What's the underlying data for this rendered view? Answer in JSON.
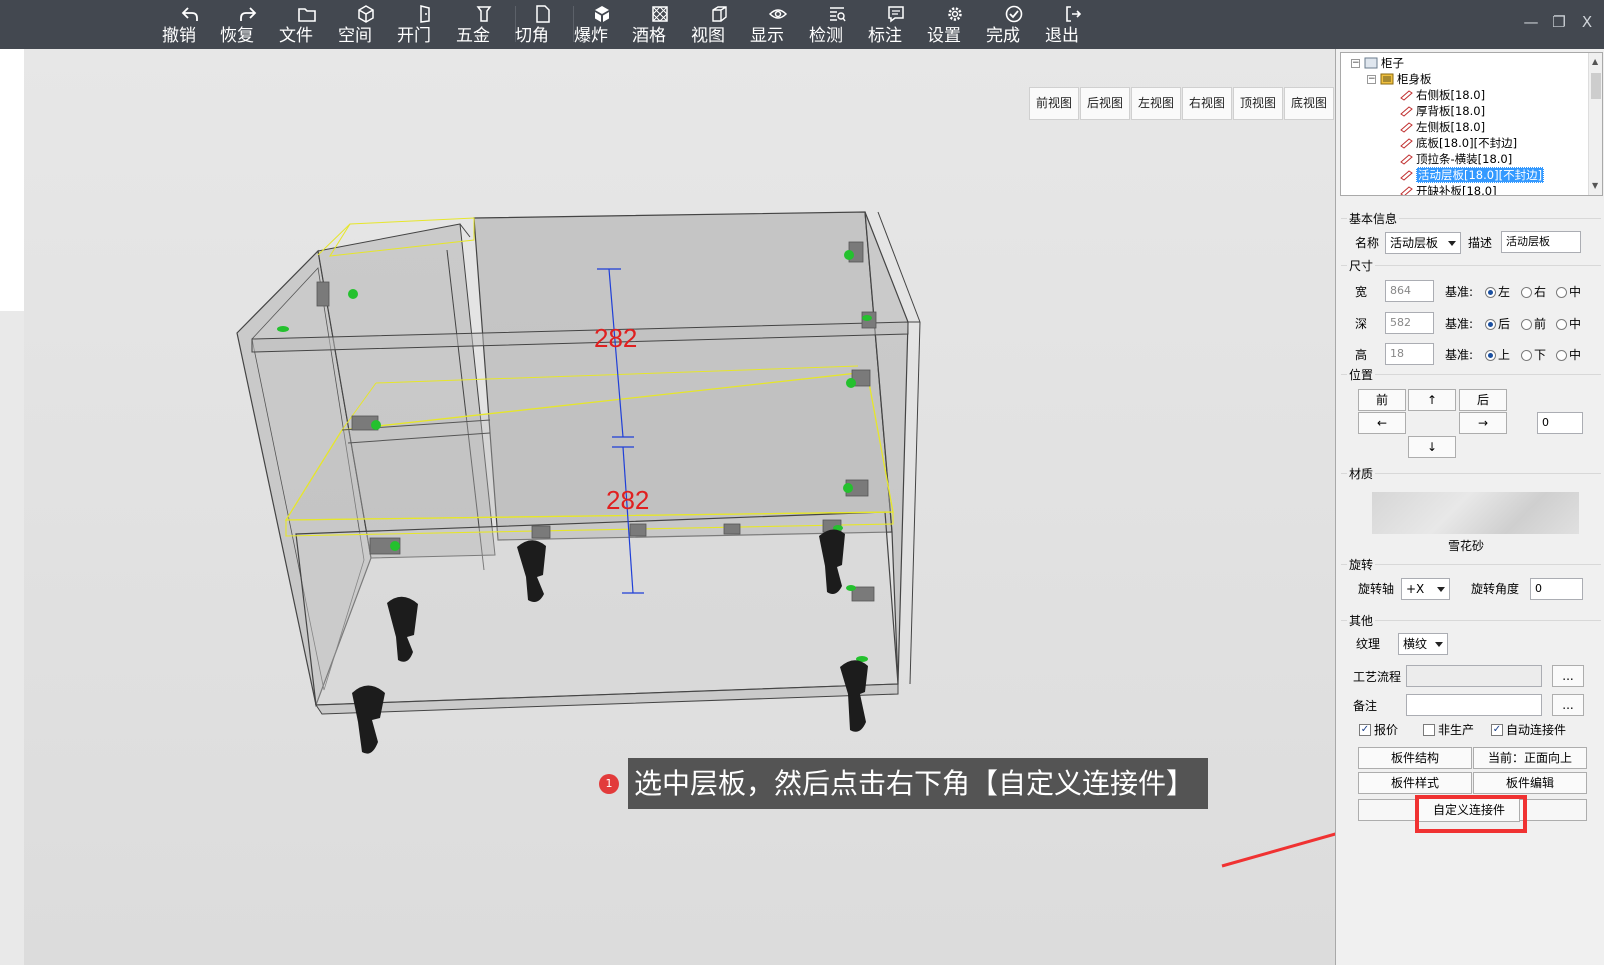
{
  "toolbar": {
    "items": [
      {
        "label": "撤销",
        "icon": "undo-icon"
      },
      {
        "label": "恢复",
        "icon": "redo-icon"
      },
      {
        "label": "文件",
        "icon": "folder-icon"
      },
      {
        "label": "空间",
        "icon": "cube-outline-icon"
      },
      {
        "label": "开门",
        "icon": "door-icon"
      },
      {
        "label": "五金",
        "icon": "hardware-icon"
      },
      {
        "label": "切角",
        "icon": "page-corner-icon"
      },
      {
        "label": "爆炸",
        "icon": "explode-cube-icon"
      },
      {
        "label": "酒格",
        "icon": "wine-grid-icon"
      },
      {
        "label": "视图",
        "icon": "view-cube-icon"
      },
      {
        "label": "显示",
        "icon": "eye-icon"
      },
      {
        "label": "检测",
        "icon": "check-list-icon"
      },
      {
        "label": "标注",
        "icon": "comment-icon"
      },
      {
        "label": "设置",
        "icon": "gear-icon"
      },
      {
        "label": "完成",
        "icon": "check-circle-icon"
      },
      {
        "label": "退出",
        "icon": "exit-icon"
      }
    ],
    "window": {
      "minimize": "—",
      "restore": "❐",
      "close": "X"
    }
  },
  "viewport": {
    "view_buttons": [
      "前视图",
      "后视图",
      "左视图",
      "右视图",
      "顶视图",
      "底视图"
    ],
    "dimension_top": "282",
    "dimension_bottom": "282",
    "callout_number": "1",
    "callout_text": "选中层板，然后点击右下角【自定义连接件】"
  },
  "tree": {
    "root": "柜子",
    "group": "柜身板",
    "items": [
      "右侧板[18.0]",
      "厚背板[18.0]",
      "左侧板[18.0]",
      "底板[18.0][不封边]",
      "顶拉条-横装[18.0]",
      "活动层板[18.0][不封边]",
      "开缺补板[18.0]"
    ],
    "selected_index": 5
  },
  "basic_info": {
    "title": "基本信息",
    "name_label": "名称",
    "name_value": "活动层板",
    "desc_label": "描述",
    "desc_value": "活动层板"
  },
  "size": {
    "title": "尺寸",
    "rows": [
      {
        "label": "宽",
        "value": "864",
        "base": "基准:",
        "options": [
          "左",
          "右",
          "中"
        ],
        "selected": 0
      },
      {
        "label": "深",
        "value": "582",
        "base": "基准:",
        "options": [
          "后",
          "前",
          "中"
        ],
        "selected": 0
      },
      {
        "label": "高",
        "value": "18",
        "base": "基准:",
        "options": [
          "上",
          "下",
          "中"
        ],
        "selected": 0
      }
    ]
  },
  "position": {
    "title": "位置",
    "front": "前",
    "up": "↑",
    "back": "后",
    "left": "←",
    "right": "→",
    "down": "↓",
    "step_value": "0"
  },
  "material": {
    "title": "材质",
    "name": "雪花砂"
  },
  "rotation": {
    "title": "旋转",
    "axis_label": "旋转轴",
    "axis_value": "+X",
    "angle_label": "旋转角度",
    "angle_value": "0"
  },
  "other": {
    "title": "其他",
    "texture_label": "纹理",
    "texture_value": "横纹",
    "process_label": "工艺流程",
    "remark_label": "备注",
    "more": "...",
    "checks": [
      {
        "label": "报价",
        "checked": true
      },
      {
        "label": "非生产",
        "checked": false
      },
      {
        "label": "自动连接件",
        "checked": true
      }
    ],
    "btn_structure": "板件结构",
    "btn_current": "当前：正面向上",
    "btn_style": "板件样式",
    "btn_edit": "板件编辑",
    "btn_custom_connector": "自定义连接件"
  },
  "colors": {
    "toolbar_bg": "#434850",
    "highlight": "#f03232",
    "dim_text": "#e02020",
    "dim_line": "#1f3fd8"
  }
}
